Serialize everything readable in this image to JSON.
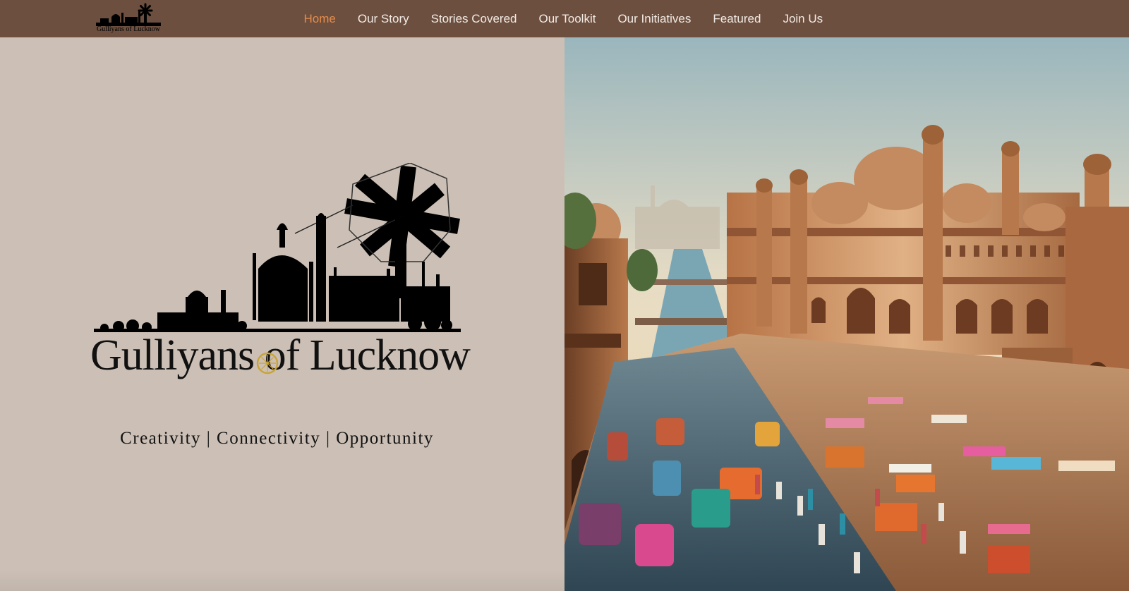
{
  "nav": {
    "logo_text": "Gulliyans of Lucknow",
    "items": [
      {
        "label": "Home",
        "active": true
      },
      {
        "label": "Our Story"
      },
      {
        "label": "Stories Covered"
      },
      {
        "label": "Our Toolkit"
      },
      {
        "label": "Our Initiatives"
      },
      {
        "label": "Featured"
      },
      {
        "label": "Join Us"
      }
    ]
  },
  "hero": {
    "title": "Gulliyans of Lucknow",
    "tagline": "Creativity | Connectivity | Opportunity"
  },
  "colors": {
    "nav_bg": "#6c4f3f",
    "nav_active": "#e58c4a",
    "nav_text": "#f2ebe5",
    "hero_left_bg": "#ccc0b6",
    "logo_accent": "#c9a437"
  },
  "icons": {
    "logo": "skyline-charkha-logo",
    "hero_image": "lucknow-street-scene"
  }
}
